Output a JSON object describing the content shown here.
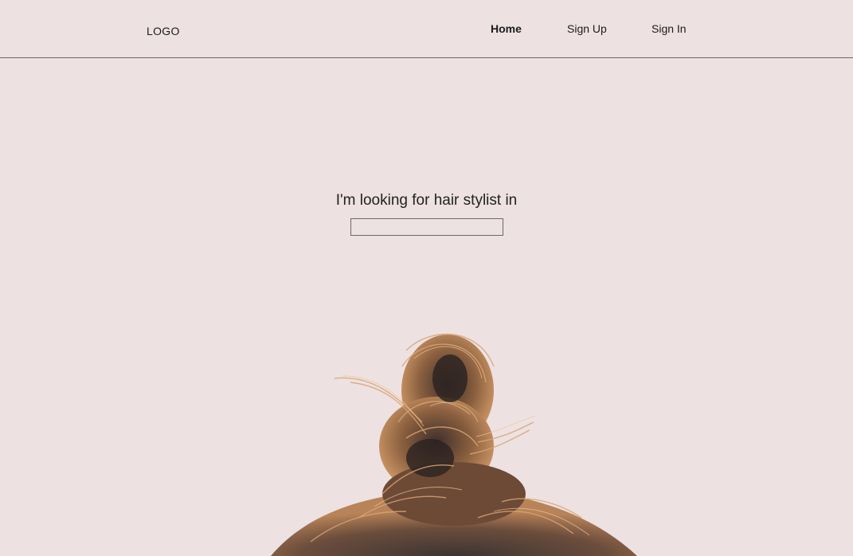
{
  "header": {
    "logo": "LOGO",
    "nav": [
      {
        "label": "Home",
        "active": true
      },
      {
        "label": "Sign Up",
        "active": false
      },
      {
        "label": "Sign In",
        "active": false
      }
    ]
  },
  "hero": {
    "heading": "I'm looking for hair stylist in",
    "input_value": "",
    "input_placeholder": ""
  },
  "colors": {
    "background": "#ede1e2",
    "text": "#1b1b1b",
    "divider": "#6e6668",
    "hair_light": "#c9925d",
    "hair_dark": "#4a3a35"
  }
}
